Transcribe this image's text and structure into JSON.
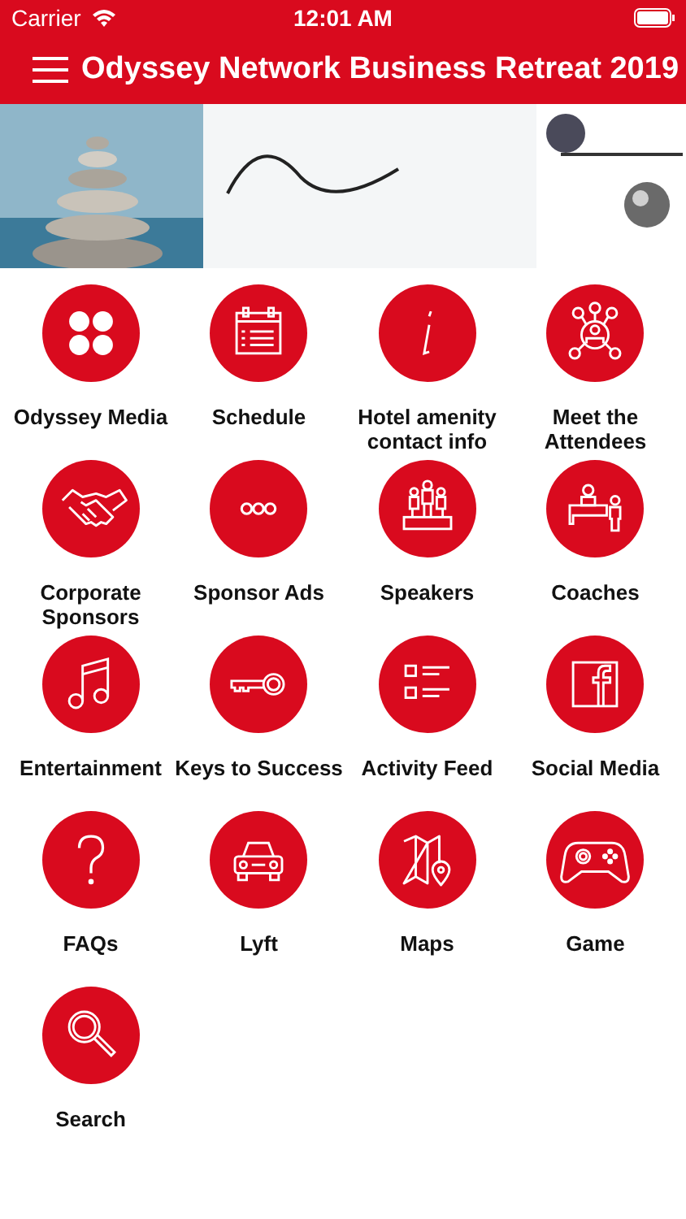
{
  "status_bar": {
    "carrier": "Carrier",
    "time": "12:01 AM"
  },
  "nav_bar": {
    "title": "Odyssey Network Business Retreat 2019"
  },
  "tiles": [
    {
      "label": "Odyssey Media"
    },
    {
      "label": "Schedule"
    },
    {
      "label": "Hotel amenity contact info"
    },
    {
      "label": "Meet the Attendees"
    },
    {
      "label": "Corporate Sponsors"
    },
    {
      "label": "Sponsor Ads"
    },
    {
      "label": "Speakers"
    },
    {
      "label": "Coaches"
    },
    {
      "label": "Entertainment"
    },
    {
      "label": "Keys to Success"
    },
    {
      "label": "Activity Feed"
    },
    {
      "label": "Social Media"
    },
    {
      "label": "FAQs"
    },
    {
      "label": "Lyft"
    },
    {
      "label": "Maps"
    },
    {
      "label": "Game"
    },
    {
      "label": "Search"
    }
  ]
}
